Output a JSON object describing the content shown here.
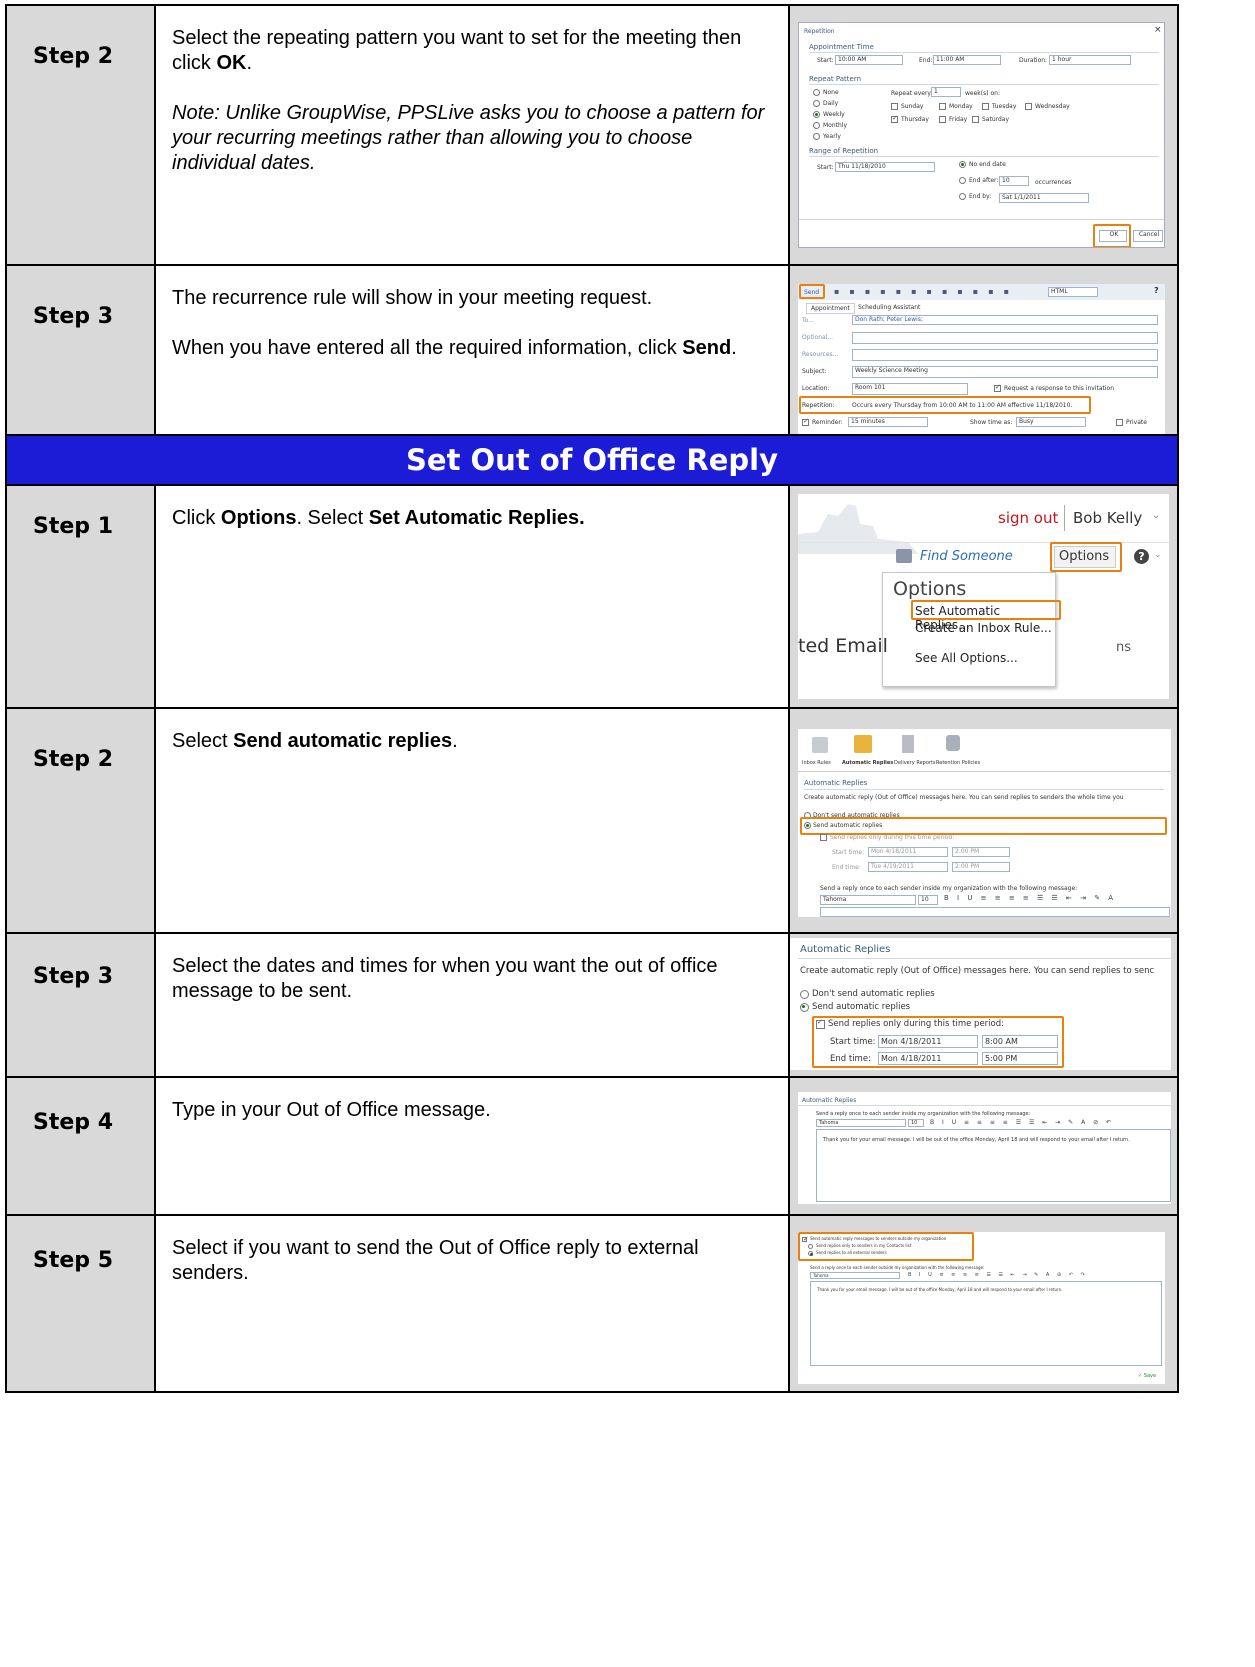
{
  "steps_top": [
    {
      "step": "Step 2",
      "text_pre": "Select the repeating pattern you want to set for the meeting then click ",
      "text_bold": "OK",
      "text_post": ".",
      "note": "Note: Unlike GroupWise, PPSLive asks you to choose a pattern for your recurring meetings rather than allowing you to choose individual dates."
    },
    {
      "step": "Step 3",
      "text1": "The recurrence rule will show in your meeting request.",
      "text2_pre": "When you have entered all the required information, click ",
      "text2_bold": "Send",
      "text2_post": "."
    }
  ],
  "section_title": "Set Out of Office Reply",
  "steps_bottom": [
    {
      "step": "Step 1",
      "pre": "Click ",
      "b1": "Options",
      "mid": ".  Select ",
      "b2": "Set Automatic Replies.",
      "post": ""
    },
    {
      "step": "Step 2",
      "pre": "Select ",
      "b1": "Send automatic replies",
      "post": "."
    },
    {
      "step": "Step 3",
      "text": "Select the dates and times for when you want the out of office message to be sent."
    },
    {
      "step": "Step 4",
      "text": "Type in your Out of Office message."
    },
    {
      "step": "Step 5",
      "text": "Select if you want to send the Out of Office reply to external senders."
    }
  ],
  "shot_repetition": {
    "title": "Repetition",
    "close": "×",
    "appt_time": "Appointment Time",
    "start_label": "Start:",
    "start_val": "10:00 AM",
    "end_label": "End:",
    "end_val": "11:00 AM",
    "duration_label": "Duration:",
    "duration_val": "1 hour",
    "repeat_pattern": "Repeat Pattern",
    "patterns": [
      "None",
      "Daily",
      "Weekly",
      "Monthly",
      "Yearly"
    ],
    "repeat_every": "Repeat every",
    "repeat_every_val": "1",
    "weeks_on": "week(s) on:",
    "days_row1": [
      "Sunday",
      "Monday",
      "Tuesday",
      "Wednesday"
    ],
    "days_row2": [
      "Thursday",
      "Friday",
      "Saturday"
    ],
    "range": "Range of Repetition",
    "range_start_label": "Start:",
    "range_start_val": "Thu 11/18/2010",
    "no_end": "No end date",
    "end_after": "End after:",
    "end_after_val": "10",
    "occurrences": "occurrences",
    "end_by": "End by:",
    "end_by_val": "Sat 1/1/2011",
    "ok": "OK",
    "cancel": "Cancel"
  },
  "shot_meeting": {
    "send": "Send",
    "format": "HTML",
    "help": "?",
    "tab_appt": "Appointment",
    "tab_sched": "Scheduling Assistant",
    "to_label": "To...",
    "to_val": "Don Rath; Peter Lewis;",
    "optional_label": "Optional...",
    "resources_label": "Resources...",
    "subject_label": "Subject:",
    "subject_val": "Weekly Science Meeting",
    "location_label": "Location:",
    "location_val": "Room 101",
    "request_response": "Request a response to this invitation",
    "repetition_label": "Repetition:",
    "repetition_val": "Occurs every Thursday from 10:00 AM to 11:00 AM effective 11/18/2010.",
    "reminder_label": "Reminder:",
    "reminder_val": "15 minutes",
    "show_time_as": "Show time as:",
    "show_time_val": "Busy",
    "private": "Private"
  },
  "shot_options": {
    "sign_out": "sign out",
    "user": "Bob Kelly",
    "find_someone": "Find Someone",
    "options_btn": "Options",
    "menu_title": "Options",
    "menu_items": [
      "Set Automatic Replies...",
      "Create an Inbox Rule...",
      "See All Options..."
    ],
    "bg_text_left": "ted Email",
    "bg_text_right": "ns"
  },
  "shot_auto_replies": {
    "toolbar": [
      "Inbox Rules",
      "Automatic Replies",
      "Delivery Reports",
      "Retention Policies"
    ],
    "heading": "Automatic Replies",
    "intro": "Create automatic reply (Out of Office) messages here. You can send replies to senders the whole time you",
    "dont_send": "Don't send automatic replies",
    "send": "Send automatic replies",
    "only_period": "Send replies only during this time period:",
    "start_time": "Start time:",
    "start_date": "Mon 4/18/2011",
    "start_hr": "2:00 PM",
    "end_time": "End time:",
    "end_date": "Tue 4/19/2011",
    "end_hr": "2:00 PM",
    "inside_msg": "Send a reply once to each sender inside my organization with the following message:",
    "font": "Tahoma",
    "size": "10"
  },
  "shot_dates": {
    "heading": "Automatic Replies",
    "intro": "Create automatic reply (Out of Office) messages here. You can send replies to senc",
    "dont_send": "Don't send automatic replies",
    "send": "Send automatic replies",
    "only_period": "Send replies only during this time period:",
    "start_time": "Start time:",
    "start_date": "Mon 4/18/2011",
    "start_hr": "8:00 AM",
    "end_time": "End time:",
    "end_date": "Mon 4/18/2011",
    "end_hr": "5:00 PM"
  },
  "shot_message": {
    "heading": "Automatic Replies",
    "inside_msg": "Send a reply once to each sender inside my organization with the following message:",
    "font": "Tahoma",
    "size": "10",
    "body": "Thank you for your email message. I will be out of the office Monday, April 18 and will respond to your email after I return."
  },
  "shot_external": {
    "outside": "Send automatic reply messages to senders outside my organization",
    "contacts_only": "Send replies only to senders in my Contacts list",
    "all_external": "Send replies to all external senders",
    "outside_msg": "Send a reply once to each sender outside my organization with the following message:",
    "font": "Tahoma",
    "body": "Thank you for your email message. I will be out of the office Monday, April 18 and will respond to your email after I return.",
    "save": "Save"
  }
}
